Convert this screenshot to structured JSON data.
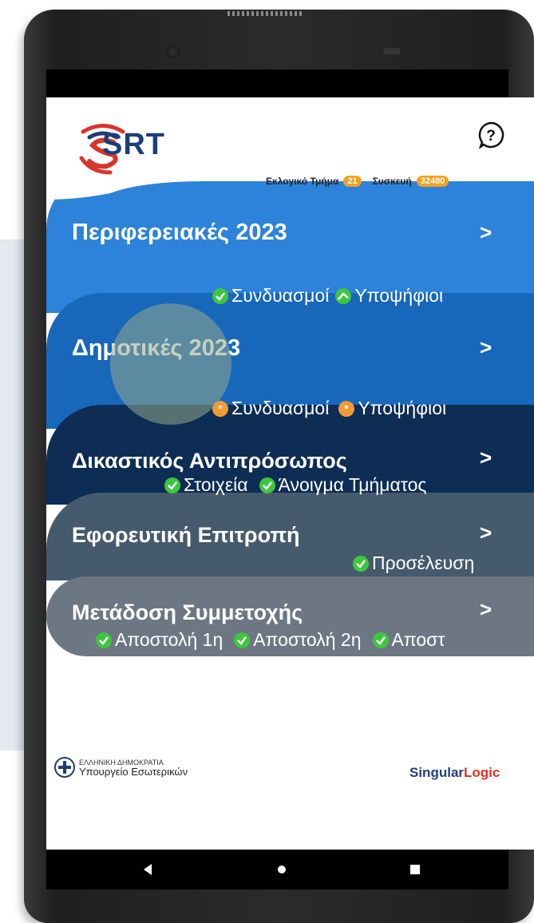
{
  "app": {
    "logo_text": "SRT"
  },
  "header": {
    "section_label": "Εκλογικό Τμήμα",
    "section_count": "21",
    "device_label": "Συσκευή",
    "device_count": "32480"
  },
  "sections": [
    {
      "title": "Περιφερειακές 2023",
      "items": [
        {
          "label": "Συνδυασμοί",
          "status": "ok"
        },
        {
          "label": "Υποψήφιοι",
          "status": "ok"
        }
      ]
    },
    {
      "title": "Δημοτικές 2023",
      "items": [
        {
          "label": "Συνδυασμοί",
          "status": "warn"
        },
        {
          "label": "Υποψήφιοι",
          "status": "warn"
        }
      ]
    },
    {
      "title": "Δικαστικός Αντιπρόσωπος",
      "items": [
        {
          "label": "Στοιχεία",
          "status": "ok"
        },
        {
          "label": "Άνοιγμα Τμήματος",
          "status": "ok"
        }
      ]
    },
    {
      "title": "Εφορευτική Επιτροπή",
      "items": [
        {
          "label": "Προσέλευση",
          "status": "ok"
        }
      ]
    },
    {
      "title": "Μετάδοση Συμμετοχής",
      "items": [
        {
          "label": "Αποστολή 1η",
          "status": "ok"
        },
        {
          "label": "Αποστολή 2η",
          "status": "ok"
        },
        {
          "label": "Αποστ",
          "status": "ok"
        }
      ]
    }
  ],
  "chevron": ">",
  "footer": {
    "ministry_line1": "ΕΛΛΗΝΙΚΗ ΔΗΜΟΚΡΑΤΙΑ",
    "ministry_line2": "Υπουργείο Εσωτερικών",
    "brand_part1": "Singular",
    "brand_part2": "Logic"
  },
  "colors": {
    "band1": "#2c83d9",
    "band2": "#1767bb",
    "band3": "#0d2d55",
    "band4": "#465a6d",
    "band5": "#6d7784",
    "ok": "#3fc63f",
    "warn": "#f39a36",
    "logo_red": "#d8352c",
    "logo_blue": "#1d3d78"
  },
  "icons": [
    "help-icon",
    "check-icon",
    "pending-icon",
    "back-icon",
    "home-icon",
    "recents-icon"
  ]
}
